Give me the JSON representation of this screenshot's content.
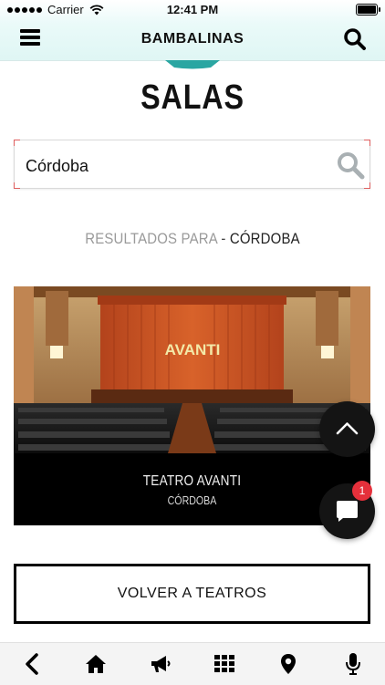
{
  "status_bar": {
    "carrier": "Carrier",
    "time": "12:41 PM"
  },
  "header": {
    "title": "BAMBALINAS"
  },
  "page": {
    "title": "SALAS"
  },
  "search": {
    "value": "Córdoba"
  },
  "results": {
    "prefix": "RESULTADOS PARA",
    "separator": " - ",
    "query": "CÓRDOBA"
  },
  "venues": [
    {
      "name": "TEATRO AVANTI",
      "city": "CÓRDOBA",
      "marquee": "AVANTI"
    }
  ],
  "chat": {
    "badge_count": "1"
  },
  "back_button": {
    "label": "VOLVER A TEATROS"
  },
  "tabbar": {
    "icons": [
      "back-chevron-icon",
      "home-icon",
      "megaphone-icon",
      "grid-icon",
      "location-pin-icon",
      "microphone-icon"
    ]
  },
  "colors": {
    "header_tint": "#dff6f4",
    "accent_teal": "#2aa6a2",
    "badge_red": "#e5303b"
  }
}
